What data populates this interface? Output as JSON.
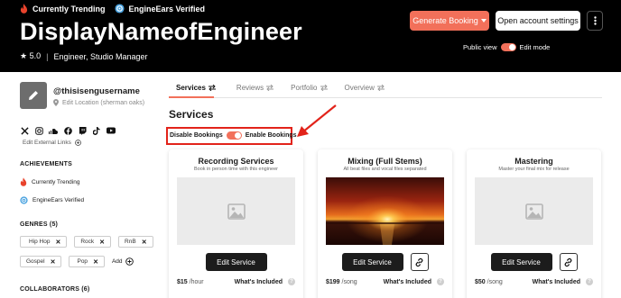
{
  "header": {
    "badges": [
      {
        "label": "Currently Trending",
        "icon": "flame-icon"
      },
      {
        "label": "EngineEars Verified",
        "icon": "verified-icon"
      }
    ],
    "display_name": "DisplayNameofEngineer",
    "rating": "★ 5.0",
    "separator": "|",
    "roles": "Engineer, Studio Manager",
    "generate_booking_label": "Generate Booking",
    "open_settings_label": "Open account settings",
    "public_view_label": "Public view",
    "edit_mode_label": "Edit mode"
  },
  "profile": {
    "username": "@thisisengusername",
    "location": "Edit Location (sherman oaks)",
    "socials": [
      "x-icon",
      "instagram-icon",
      "soundcloud-icon",
      "facebook-icon",
      "twitch-icon",
      "tiktok-icon",
      "youtube-icon"
    ],
    "edit_links_label": "Edit External Links"
  },
  "achievements": {
    "heading": "ACHIEVEMENTS",
    "items": [
      {
        "label": "Currently Trending",
        "icon": "flame-icon"
      },
      {
        "label": "EngineEars Verified",
        "icon": "verified-icon"
      }
    ]
  },
  "genres": {
    "heading": "GENRES (5)",
    "items": [
      "Hip Hop",
      "Rock",
      "RnB",
      "Gospel",
      "Pop"
    ],
    "add_label": "Add"
  },
  "collaborators": {
    "heading": "COLLABORATORS (6)"
  },
  "tabs": [
    "Services",
    "Reviews",
    "Portfolio",
    "Overview"
  ],
  "services_heading": "Services",
  "bookings": {
    "disable_label": "Disable Bookings",
    "enable_label": "Enable Bookings"
  },
  "cards": [
    {
      "title": "Recording Services",
      "desc": "Book in person time with this engineer",
      "edit_label": "Edit Service",
      "price": "$15",
      "unit": "/hour",
      "included_label": "What's Included",
      "has_image": false,
      "has_link": false
    },
    {
      "title": "Mixing (Full Stems)",
      "desc": "All beat files and vocal files separated",
      "edit_label": "Edit Service",
      "price": "$199",
      "unit": "/song",
      "included_label": "What's Included",
      "has_image": true,
      "has_link": true
    },
    {
      "title": "Mastering",
      "desc": "Master your final mix for release",
      "edit_label": "Edit Service",
      "price": "$50",
      "unit": "/song",
      "included_label": "What's Included",
      "has_image": false,
      "has_link": true
    }
  ],
  "colors": {
    "accent": "#f2705a",
    "annotation": "#e2231a",
    "header_bg": "#000000"
  }
}
